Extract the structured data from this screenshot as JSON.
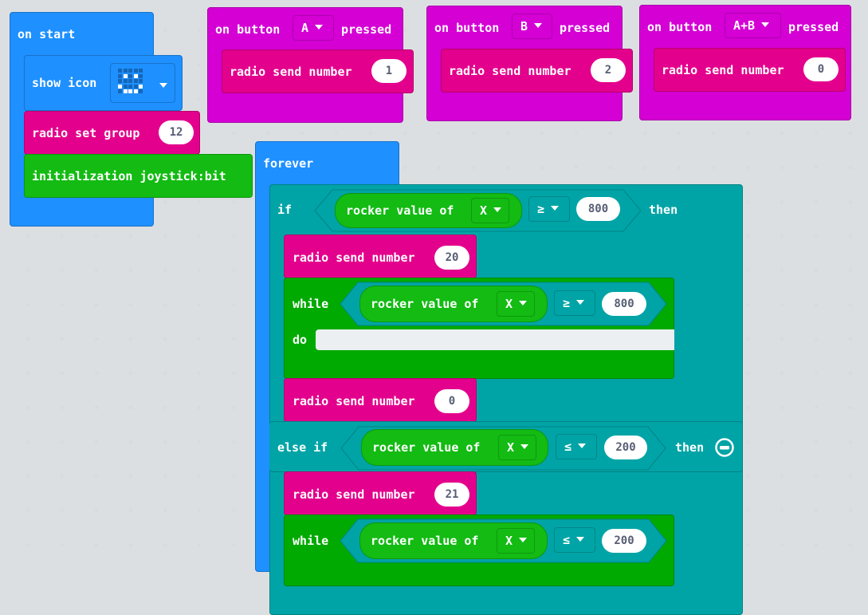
{
  "colors": {
    "background": "#eceff1",
    "basic_blue": "#1e90ff",
    "input_magenta": "#d400d4",
    "radio_pink": "#e3008c",
    "joystick_green": "#13bb13",
    "loop_green": "#00aa00",
    "logic_teal": "#00a4a6"
  },
  "on_start": {
    "label": "on start",
    "show_icon": {
      "label": "show icon",
      "icon_name": "smiley-face-icon",
      "leds": [
        [
          0,
          0,
          0,
          0,
          0
        ],
        [
          0,
          1,
          0,
          1,
          0
        ],
        [
          0,
          0,
          0,
          0,
          0
        ],
        [
          1,
          0,
          0,
          0,
          1
        ],
        [
          0,
          1,
          1,
          1,
          0
        ]
      ]
    },
    "radio_set_group": {
      "label": "radio set group",
      "value": "12"
    },
    "init": {
      "label": "initialization joystick:bit"
    }
  },
  "button_handlers": [
    {
      "prefix": "on button",
      "button": "A",
      "suffix": "pressed",
      "send_label": "radio send number",
      "value": "1"
    },
    {
      "prefix": "on button",
      "button": "B",
      "suffix": "pressed",
      "send_label": "radio send number",
      "value": "2"
    },
    {
      "prefix": "on button",
      "button": "A+B",
      "suffix": "pressed",
      "send_label": "radio send number",
      "value": "0"
    }
  ],
  "forever": {
    "label": "forever",
    "if_block": {
      "if_label": "if",
      "then_label": "then",
      "condition": {
        "sensor_label": "rocker value of",
        "axis": "X",
        "operator": "≥",
        "value": "800"
      },
      "send1": {
        "label": "radio send number",
        "value": "20"
      },
      "while": {
        "label": "while",
        "do_label": "do",
        "condition": {
          "sensor_label": "rocker value of",
          "axis": "X",
          "operator": "≥",
          "value": "800"
        }
      },
      "send2": {
        "label": "radio send number",
        "value": "0"
      }
    },
    "else_if_block": {
      "label": "else if",
      "then_label": "then",
      "remove_icon": "minus-circle-icon",
      "condition": {
        "sensor_label": "rocker value of",
        "axis": "X",
        "operator": "≤",
        "value": "200"
      },
      "send1": {
        "label": "radio send number",
        "value": "21"
      },
      "while": {
        "label": "while",
        "condition": {
          "sensor_label": "rocker value of",
          "axis": "X",
          "operator": "≤",
          "value": "200"
        }
      }
    }
  }
}
